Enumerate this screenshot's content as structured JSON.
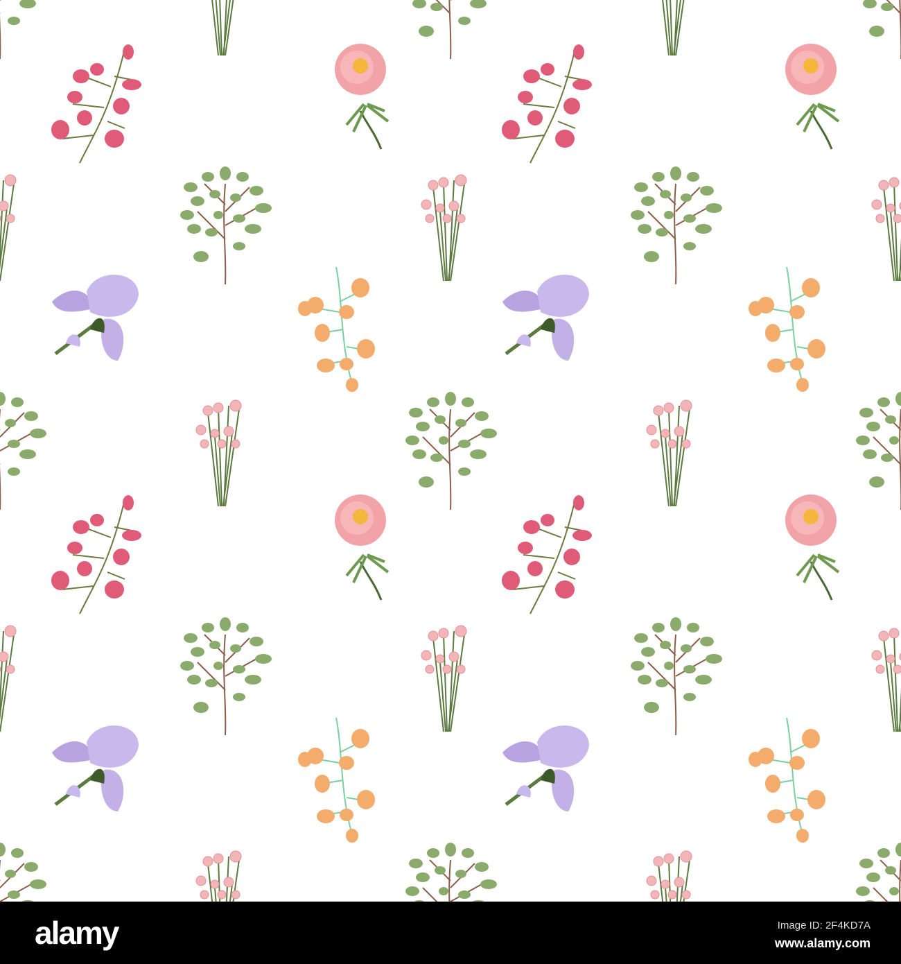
{
  "watermark": {
    "logo": "alamy",
    "image_id": "Image ID: 2F4KD7A",
    "url": "www.alamy.com"
  },
  "colors": {
    "leaf": "#8aab6c",
    "stem": "#5a6b3e",
    "sweet_pea": "#e05b78",
    "peony": "#f2a3a8",
    "peony_center": "#f5b63c",
    "rose": "#f2b6b9",
    "iris": "#c3b0e6",
    "orange_flower": "#f3ac6b"
  }
}
